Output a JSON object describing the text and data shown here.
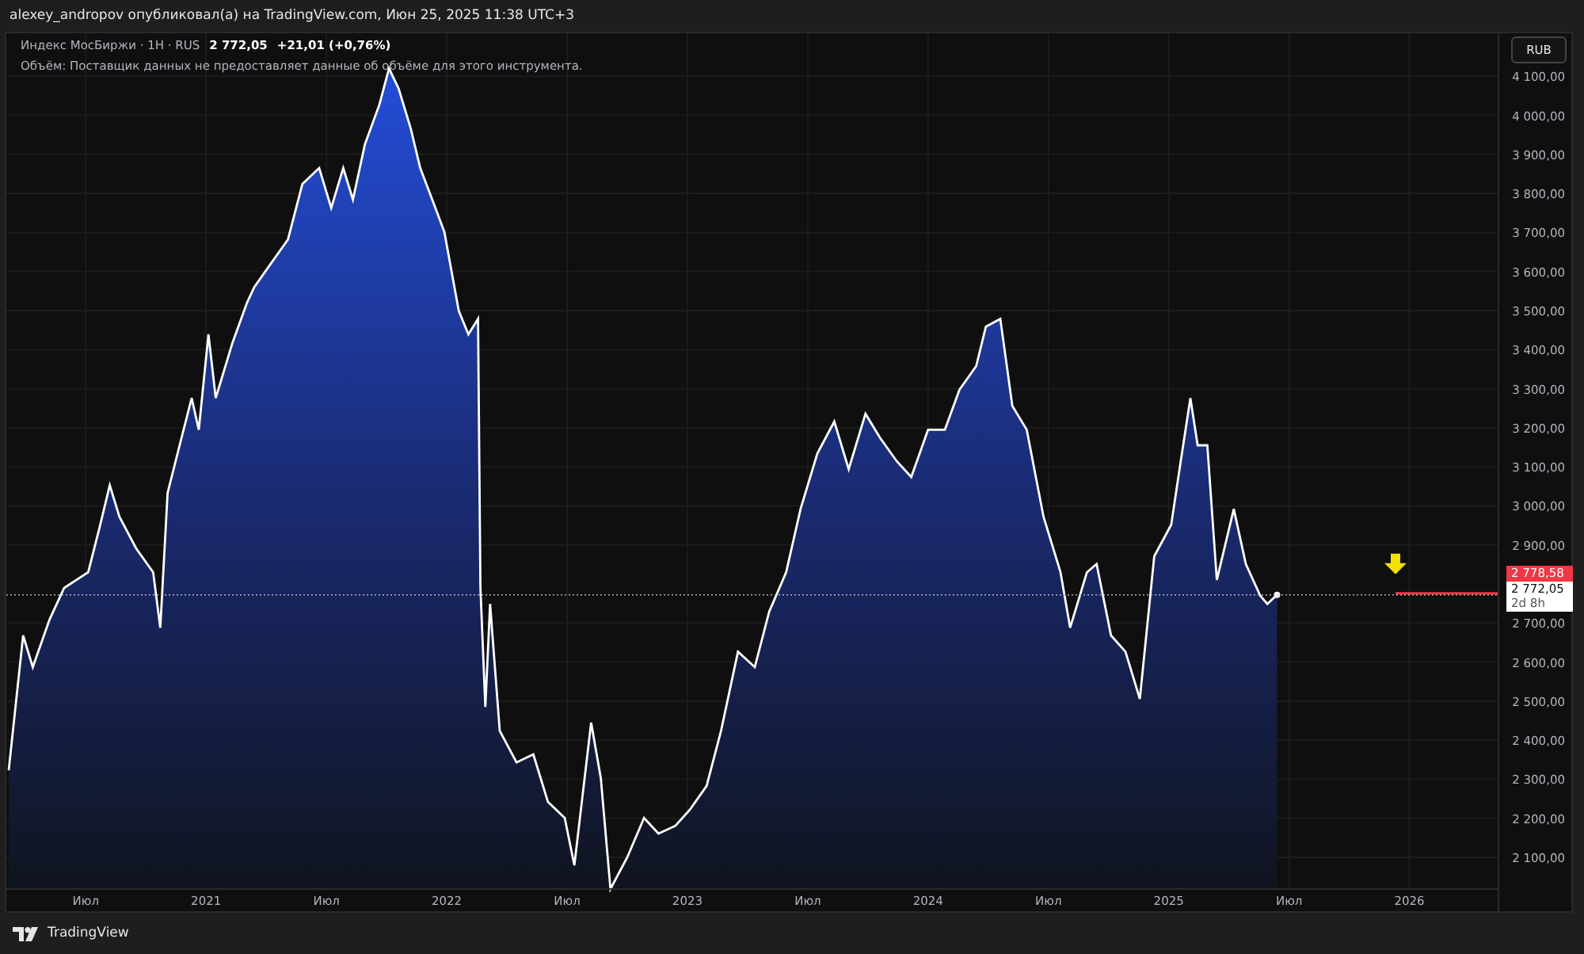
{
  "header": {
    "text": "alexey_andropov опубликовал(а) на TradingView.com, Июн 25, 2025 11:38 UTC+3"
  },
  "legend": {
    "symbol": "Индекс МосБиржи · 1H · RUS",
    "price": "2 772,05",
    "change": "+21,01 (+0,76%)",
    "note": "Объём: Поставщик данных не предоставляет данные об объёме для этого инструмента."
  },
  "currency_button": "RUB",
  "price_tags": [
    {
      "kind": "alert",
      "text": "2 778,58"
    },
    {
      "kind": "last",
      "text": "2 772,05",
      "countdown": "2d 8h"
    }
  ],
  "chart_data": {
    "type": "area",
    "x": [
      2020.18,
      2020.24,
      2020.28,
      2020.35,
      2020.41,
      2020.51,
      2020.56,
      2020.6,
      2020.64,
      2020.71,
      2020.78,
      2020.81,
      2020.84,
      2020.89,
      2020.94,
      2020.97,
      2021.01,
      2021.04,
      2021.11,
      2021.17,
      2021.2,
      2021.27,
      2021.34,
      2021.4,
      2021.47,
      2021.52,
      2021.57,
      2021.61,
      2021.66,
      2021.72,
      2021.76,
      2021.8,
      2021.85,
      2021.89,
      2021.94,
      2021.99,
      2022.05,
      2022.09,
      2022.13,
      2022.14,
      2022.16,
      2022.18,
      2022.22,
      2022.29,
      2022.36,
      2022.42,
      2022.49,
      2022.53,
      2022.6,
      2022.64,
      2022.68,
      2022.75,
      2022.82,
      2022.88,
      2022.95,
      2023.01,
      2023.08,
      2023.14,
      2023.21,
      2023.28,
      2023.34,
      2023.41,
      2023.47,
      2023.54,
      2023.61,
      2023.67,
      2023.74,
      2023.8,
      2023.87,
      2023.93,
      2024.0,
      2024.07,
      2024.13,
      2024.2,
      2024.24,
      2024.3,
      2024.35,
      2024.41,
      2024.48,
      2024.55,
      2024.59,
      2024.66,
      2024.7,
      2024.76,
      2024.82,
      2024.88,
      2024.94,
      2025.01,
      2025.05,
      2025.09,
      2025.12,
      2025.16,
      2025.2,
      2025.27,
      2025.32,
      2025.38,
      2025.41,
      2025.45
    ],
    "grid": true,
    "ref_lines": [
      {
        "value": 2772.05,
        "axis": "y"
      }
    ],
    "series": [
      {
        "color": "#ffffff",
        "values": [
          2323,
          2668,
          2587,
          2709,
          2790,
          2830,
          2952,
          3053,
          2972,
          2891,
          2830,
          2688,
          3033,
          3155,
          3276,
          3195,
          3439,
          3276,
          3418,
          3520,
          3560,
          3621,
          3682,
          3824,
          3865,
          3763,
          3865,
          3784,
          3926,
          4027,
          4120,
          4068,
          3966,
          3865,
          3784,
          3702,
          3500,
          3439,
          3479,
          2790,
          2485,
          2749,
          2424,
          2343,
          2364,
          2242,
          2201,
          2080,
          2445,
          2303,
          2019,
          2100,
          2201,
          2161,
          2181,
          2222,
          2283,
          2424,
          2627,
          2587,
          2729,
          2830,
          2992,
          3134,
          3216,
          3094,
          3236,
          3175,
          3114,
          3074,
          3195,
          3195,
          3297,
          3358,
          3459,
          3479,
          3256,
          3195,
          2972,
          2830,
          2688,
          2830,
          2851,
          2668,
          2627,
          2506,
          2871,
          2952,
          3114,
          3276,
          3155,
          3155,
          2810,
          2992,
          2851,
          2770,
          2749,
          2772
        ]
      }
    ],
    "xlim": [
      2020.17,
      2026.37
    ],
    "ylim": [
      2019,
      4210
    ],
    "xticks": [
      {
        "value": 2020.5,
        "label": "Июл"
      },
      {
        "value": 2021,
        "label": "2021"
      },
      {
        "value": 2021.5,
        "label": "Июл"
      },
      {
        "value": 2022,
        "label": "2022"
      },
      {
        "value": 2022.5,
        "label": "Июл"
      },
      {
        "value": 2023,
        "label": "2023"
      },
      {
        "value": 2023.5,
        "label": "Июл"
      },
      {
        "value": 2024,
        "label": "2024"
      },
      {
        "value": 2024.5,
        "label": "Июл"
      },
      {
        "value": 2025,
        "label": "2025"
      },
      {
        "value": 2025.5,
        "label": "Июл"
      },
      {
        "value": 2026,
        "label": "2026"
      }
    ],
    "yticks": [
      {
        "value": 2100,
        "label": "2 100,00"
      },
      {
        "value": 2200,
        "label": "2 200,00"
      },
      {
        "value": 2300,
        "label": "2 300,00"
      },
      {
        "value": 2400,
        "label": "2 400,00"
      },
      {
        "value": 2500,
        "label": "2 500,00"
      },
      {
        "value": 2600,
        "label": "2 600,00"
      },
      {
        "value": 2700,
        "label": "2 700,00"
      },
      {
        "value": 2900,
        "label": "2 900,00"
      },
      {
        "value": 3000,
        "label": "3 000,00"
      },
      {
        "value": 3100,
        "label": "3 100,00"
      },
      {
        "value": 3200,
        "label": "3 200,00"
      },
      {
        "value": 3300,
        "label": "3 300,00"
      },
      {
        "value": 3400,
        "label": "3 400,00"
      },
      {
        "value": 3500,
        "label": "3 500,00"
      },
      {
        "value": 3600,
        "label": "3 600,00"
      },
      {
        "value": 3700,
        "label": "3 700,00"
      },
      {
        "value": 3800,
        "label": "3 800,00"
      },
      {
        "value": 3900,
        "label": "3 900,00"
      },
      {
        "value": 4000,
        "label": "4 000,00"
      },
      {
        "value": 4100,
        "label": "4 100,00"
      }
    ]
  },
  "footer": {
    "logo": "TradingView"
  }
}
